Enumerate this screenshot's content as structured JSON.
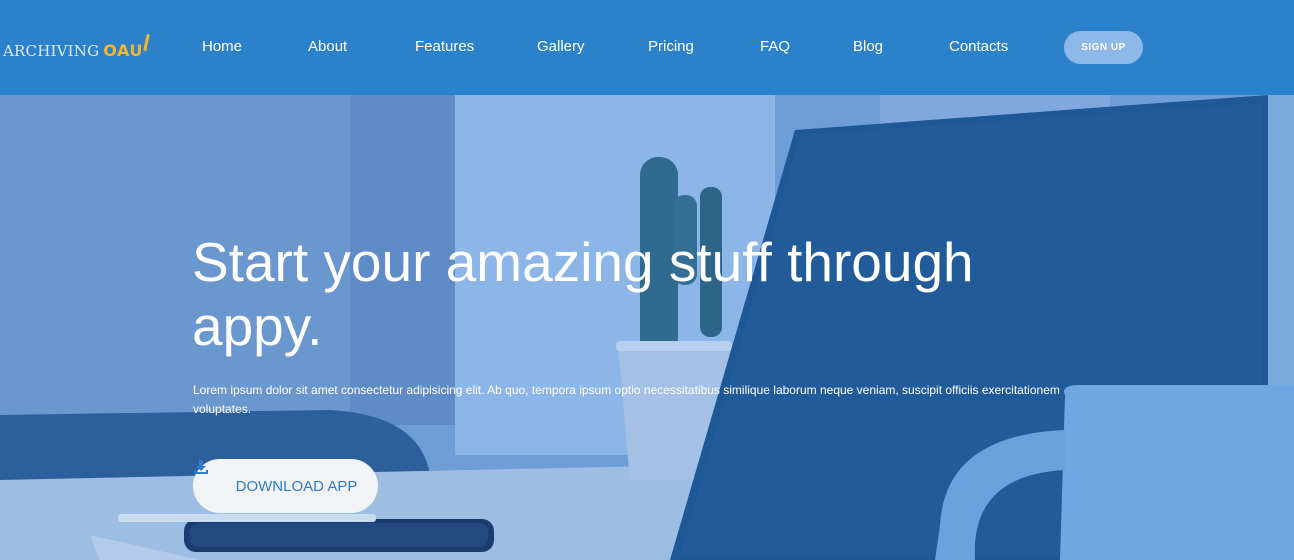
{
  "header": {
    "logo_primary": "ARCHIVING",
    "logo_secondary": "OAU",
    "nav": [
      "Home",
      "About",
      "Features",
      "Gallery",
      "Pricing",
      "FAQ",
      "Blog",
      "Contacts"
    ],
    "signup_label": "SIGN UP"
  },
  "hero": {
    "title": "Start your amazing stuff through appy.",
    "description": "Lorem ipsum dolor sit amet consectetur adipisicing elit. Ab quo, tempora ipsum optio necessitatibus similique laborum neque veniam, suscipit officiis exercitationem voluptates.",
    "download_label": "DOWNLOAD APP",
    "download_icon": "download-icon"
  },
  "colors": {
    "nav_background": "#2b82cb",
    "signup_background": "#8db9e8",
    "logo_accent": "#f2b632",
    "button_text": "#2f7ccb"
  }
}
